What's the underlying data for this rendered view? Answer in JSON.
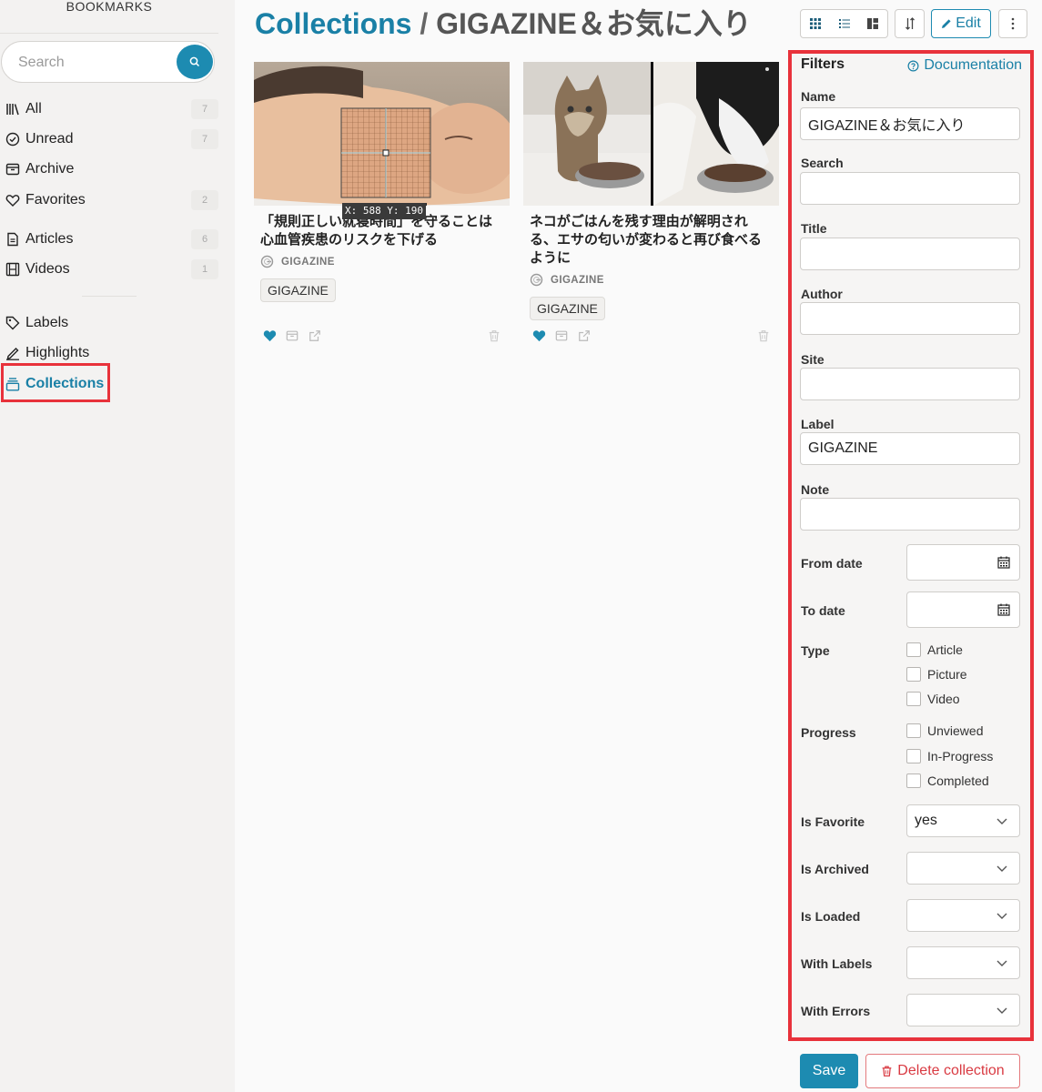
{
  "sidebar": {
    "brand": "BOOKMARKS",
    "search_placeholder": "Search",
    "items": [
      {
        "label": "All",
        "count": "7"
      },
      {
        "label": "Unread",
        "count": "7"
      },
      {
        "label": "Archive",
        "count": ""
      },
      {
        "label": "Favorites",
        "count": "2"
      },
      {
        "label": "Articles",
        "count": "6"
      },
      {
        "label": "Videos",
        "count": "1"
      },
      {
        "label": "Labels"
      },
      {
        "label": "Highlights"
      },
      {
        "label": "Collections"
      }
    ]
  },
  "header": {
    "crumb": "Collections",
    "separator": "/",
    "name": "GIGAZINE＆お気に入り",
    "edit_label": "Edit"
  },
  "cards": [
    {
      "title": "「規則正しい就寝時間」を守ることは心血管疾患のリスクを下げる",
      "site": "GIGAZINE",
      "tag": "GIGAZINE",
      "overlay_readout": "X: 588 Y: 190"
    },
    {
      "title": "ネコがごはんを残す理由が解明される、エサの匂いが変わると再び食べるように",
      "site": "GIGAZINE",
      "tag": "GIGAZINE"
    }
  ],
  "filters": {
    "heading": "Filters",
    "doc_link": "Documentation",
    "name_label": "Name",
    "name_value": "GIGAZINE＆お気に入り",
    "search_label": "Search",
    "title_label": "Title",
    "author_label": "Author",
    "site_label": "Site",
    "label_label": "Label",
    "label_value": "GIGAZINE",
    "note_label": "Note",
    "from_date_label": "From date",
    "to_date_label": "To date",
    "type_label": "Type",
    "type_options": [
      "Article",
      "Picture",
      "Video"
    ],
    "progress_label": "Progress",
    "progress_options": [
      "Unviewed",
      "In-Progress",
      "Completed"
    ],
    "is_favorite_label": "Is Favorite",
    "is_favorite_value": "yes",
    "is_archived_label": "Is Archived",
    "is_loaded_label": "Is Loaded",
    "with_labels_label": "With Labels",
    "with_errors_label": "With Errors"
  },
  "actions": {
    "save_label": "Save",
    "delete_label": "Delete collection"
  },
  "colors": {
    "accent": "#1a80a6",
    "highlight": "#e8323b",
    "danger": "#d93a42"
  }
}
